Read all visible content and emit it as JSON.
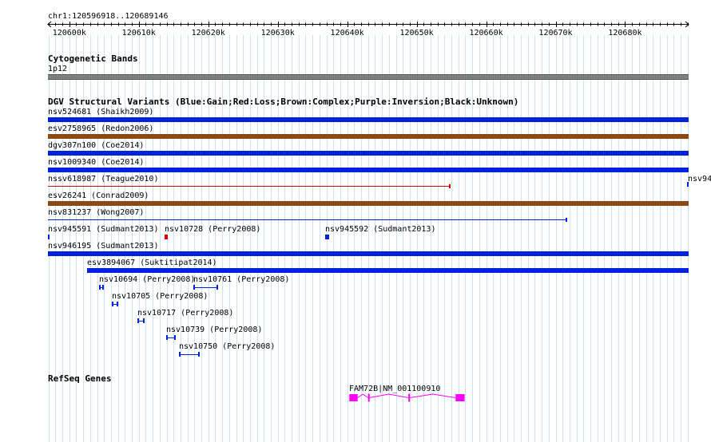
{
  "ruler": {
    "location": "chr1:120596918..120689146",
    "start": 120596918,
    "end": 120689146,
    "ticks": [
      {
        "label": "120600k",
        "pos": 120600000
      },
      {
        "label": "120610k",
        "pos": 120610000
      },
      {
        "label": "120620k",
        "pos": 120620000
      },
      {
        "label": "120630k",
        "pos": 120630000
      },
      {
        "label": "120640k",
        "pos": 120640000
      },
      {
        "label": "120650k",
        "pos": 120650000
      },
      {
        "label": "120660k",
        "pos": 120660000
      },
      {
        "label": "120670k",
        "pos": 120670000
      },
      {
        "label": "120680k",
        "pos": 120680000
      }
    ]
  },
  "colors": {
    "gain": "#0022dd",
    "loss": "#dd0000",
    "complex": "#8b4a14",
    "band": "#808080",
    "gene": "#ff00ff",
    "grid": "#c8e4f0"
  },
  "tracks": {
    "cyto": {
      "title": "Cytogenetic Bands",
      "band_label": "1p12"
    },
    "dgv": {
      "title": "DGV Structural Variants (Blue:Gain;Red:Loss;Brown:Complex;Purple:Inversion;Black:Unknown)",
      "variants": [
        {
          "label": "nsv524681 (Shaikh2009)",
          "start": 120596918,
          "end": 120689146,
          "type": "gain",
          "row": 0
        },
        {
          "label": "esv2758965 (Redon2006)",
          "start": 120596918,
          "end": 120689146,
          "type": "complex",
          "row": 1
        },
        {
          "label": "dgv307n100 (Coe2014)",
          "start": 120596918,
          "end": 120689146,
          "type": "gain",
          "row": 2
        },
        {
          "label": "nsv1009340 (Coe2014)",
          "start": 120596918,
          "end": 120689146,
          "type": "gain",
          "row": 3
        },
        {
          "label": "nssv618987 (Teague2010)",
          "start": 120596918,
          "end": 120654800,
          "type": "loss",
          "row": 4,
          "style": "thin"
        },
        {
          "label": "nsv94",
          "start": 120689000,
          "end": 120689146,
          "type": "gain",
          "row": 4,
          "style": "tick"
        },
        {
          "label": "esv26241 (Conrad2009)",
          "start": 120596918,
          "end": 120689146,
          "type": "complex",
          "row": 5
        },
        {
          "label": "nsv831237 (Wong2007)",
          "start": 120596918,
          "end": 120671600,
          "type": "gain",
          "row": 6,
          "style": "thin"
        },
        {
          "label": "nsv945591 (Sudmant2013)",
          "start": 120596918,
          "end": 120597200,
          "type": "gain",
          "row": 7,
          "style": "small"
        },
        {
          "label": "nsv10728 (Perry2008)",
          "start": 120613700,
          "end": 120614200,
          "type": "loss",
          "row": 7,
          "style": "small"
        },
        {
          "label": "nsv945592 (Sudmant2013)",
          "start": 120636800,
          "end": 120637400,
          "type": "gain",
          "row": 7,
          "style": "small"
        },
        {
          "label": "nsv946195 (Sudmant2013)",
          "start": 120596918,
          "end": 120689146,
          "type": "gain",
          "row": 8
        },
        {
          "label": "esv3894067 (Suktitipat2014)",
          "start": 120602600,
          "end": 120689146,
          "type": "gain",
          "row": 9
        },
        {
          "label": "nsv10694 (Perry2008)",
          "start": 120604300,
          "end": 120605000,
          "type": "gain",
          "row": 10,
          "style": "bracket"
        },
        {
          "label": "nsv10761 (Perry2008)",
          "start": 120617900,
          "end": 120621500,
          "type": "gain",
          "row": 10,
          "style": "bracket"
        },
        {
          "label": "nsv10705 (Perry2008)",
          "start": 120606100,
          "end": 120607000,
          "type": "gain",
          "row": 11,
          "style": "bracket"
        },
        {
          "label": "nsv10717 (Perry2008)",
          "start": 120609800,
          "end": 120610800,
          "type": "gain",
          "row": 12,
          "style": "bracket"
        },
        {
          "label": "nsv10739 (Perry2008)",
          "start": 120613900,
          "end": 120615300,
          "type": "gain",
          "row": 13,
          "style": "bracket"
        },
        {
          "label": "nsv10750 (Perry2008)",
          "start": 120615800,
          "end": 120618800,
          "type": "gain",
          "row": 14,
          "style": "bracket"
        }
      ]
    },
    "refseq": {
      "title": "RefSeq Genes",
      "gene": {
        "label": "FAM72B|NM_001100910",
        "start": 120640300,
        "end": 120656900,
        "exons": [
          [
            120640300,
            120641500
          ],
          [
            120643000,
            120643200
          ],
          [
            120648800,
            120649000
          ],
          [
            120655600,
            120656900
          ]
        ]
      }
    }
  }
}
